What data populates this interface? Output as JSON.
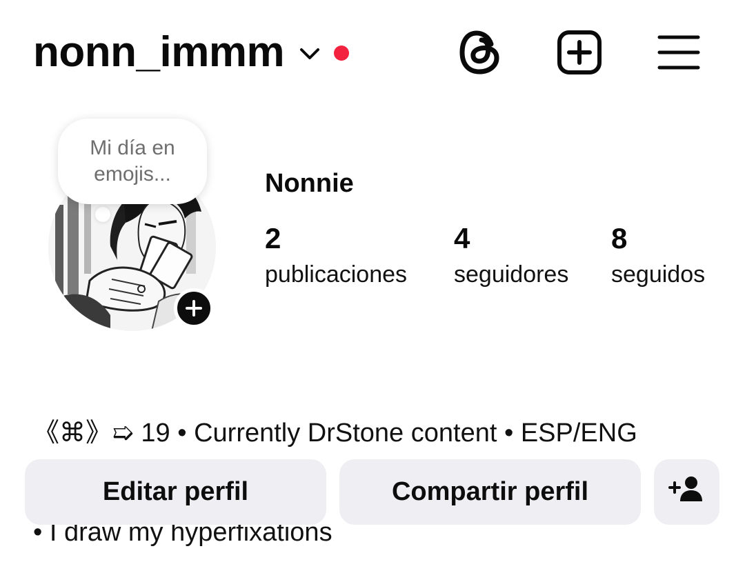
{
  "header": {
    "username": "nonn_immm",
    "live_dot_color": "#f3223f",
    "icons": [
      "chevron-down-icon",
      "threads-icon",
      "create-plus-icon",
      "hamburger-menu-icon"
    ]
  },
  "profile": {
    "note_text": "Mi día en emojis...",
    "display_name": "Nonnie",
    "stats": [
      {
        "value": "2",
        "label": "publicaciones"
      },
      {
        "value": "4",
        "label": "seguidores"
      },
      {
        "value": "8",
        "label": "seguidos"
      }
    ]
  },
  "bio": {
    "line1": "《⌘》➯ 19 • Currently DrStone content • ESP/ENG",
    "line2": "• I draw my hyperfixations"
  },
  "buttons": {
    "edit_label": "Editar perfil",
    "share_label": "Compartir perfil",
    "add_user_icon": "add-person-icon"
  },
  "colors": {
    "button_bg": "#efeff3",
    "text": "#0a0a0a",
    "note_text": "#6e6e6e"
  }
}
